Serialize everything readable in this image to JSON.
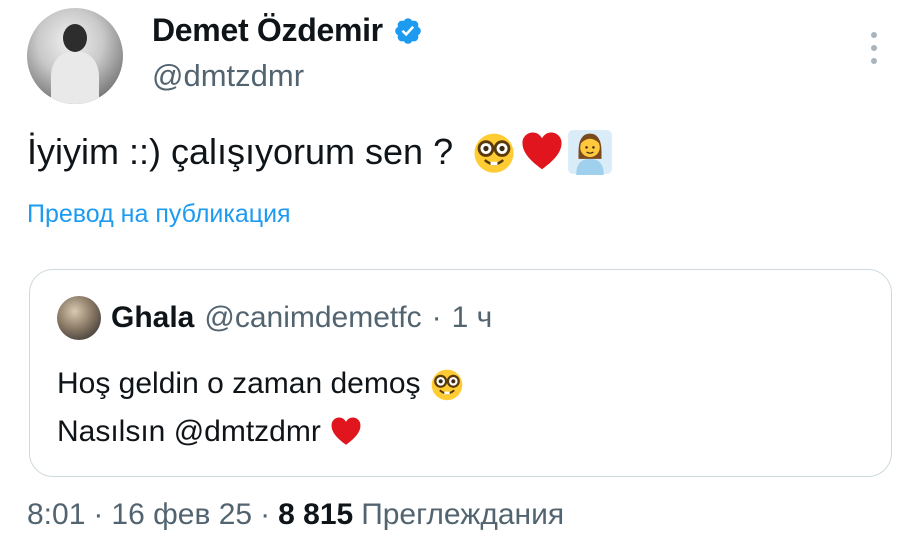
{
  "author": {
    "display_name": "Demet Özdemir",
    "handle": "@dmtzdmr",
    "verified_icon": "verified-badge-icon"
  },
  "tweet": {
    "text": "İyiyim ::) çalışıyorum sen ?",
    "emojis": [
      "nerd-face-icon",
      "red-heart-icon",
      "woman-health-worker-icon"
    ],
    "translate_label": "Превод на публикация"
  },
  "quote": {
    "name": "Ghala",
    "handle": "@canimdemetfc",
    "separator": "·",
    "time": "1 ч",
    "line1": "Hoş geldin o zaman demoş",
    "line2": "Nasılsın @dmtzdmr"
  },
  "meta": {
    "time": "8:01",
    "sep1": "·",
    "date": "16 фев 25",
    "sep2": "·",
    "views_count": "8 815",
    "views_label": "Преглеждания"
  },
  "colors": {
    "accent": "#1d9bf0",
    "secondary_text": "#536471",
    "border": "#cfd9de"
  }
}
